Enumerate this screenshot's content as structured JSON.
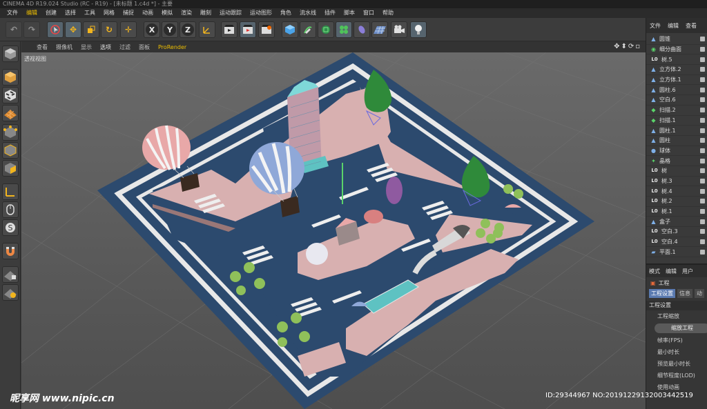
{
  "window": {
    "title": "CINEMA 4D R19.024 Studio (RC - R19) - [未标题 1.c4d *] - 主要"
  },
  "menu": [
    "文件",
    "编辑",
    "创建",
    "选择",
    "工具",
    "网格",
    "捕捉",
    "动画",
    "模拟",
    "渲染",
    "雕刻",
    "运动跟踪",
    "运动图形",
    "角色",
    "流水线",
    "插件",
    "脚本",
    "窗口",
    "帮助"
  ],
  "toolbar": {
    "axis_x": "X",
    "axis_y": "Y",
    "axis_z": "Z",
    "icons": [
      "undo-icon",
      "redo-icon",
      "select-icon",
      "move-icon",
      "scale-icon",
      "rotate-icon",
      "live-select-icon",
      "x-axis-icon",
      "y-axis-icon",
      "z-axis-icon",
      "coord-system-icon",
      "render-view-icon",
      "render-picture-icon",
      "render-settings-icon",
      "cube-icon",
      "pen-icon",
      "subdivide-icon",
      "array-icon",
      "deformer-icon",
      "floor-icon",
      "camera-icon",
      "light-icon"
    ]
  },
  "viewport": {
    "menu": [
      "查看",
      "摄像机",
      "显示",
      "选项",
      "过滤",
      "面板",
      "ProRender"
    ],
    "label": "透视视图"
  },
  "object_manager": {
    "tabs": [
      "文件",
      "编辑",
      "查看"
    ],
    "items": [
      {
        "label": "圆锥",
        "icon": "cone-icon"
      },
      {
        "label": "细分曲面",
        "icon": "subdivision-icon"
      },
      {
        "label": "树.5",
        "icon": "null-icon"
      },
      {
        "label": "立方体.2",
        "icon": "cube-icon"
      },
      {
        "label": "立方体.1",
        "icon": "cube-icon"
      },
      {
        "label": "圆柱.6",
        "icon": "cylinder-icon"
      },
      {
        "label": "空白.6",
        "icon": "null-icon"
      },
      {
        "label": "扫描.2",
        "icon": "sweep-icon"
      },
      {
        "label": "扫描.1",
        "icon": "sweep-icon"
      },
      {
        "label": "圆柱.1",
        "icon": "cylinder-icon"
      },
      {
        "label": "圆柱",
        "icon": "cylinder-icon"
      },
      {
        "label": "球体",
        "icon": "sphere-icon"
      },
      {
        "label": "晶格",
        "icon": "lattice-icon"
      },
      {
        "label": "树",
        "icon": "null-icon"
      },
      {
        "label": "树.3",
        "icon": "null-icon"
      },
      {
        "label": "树.4",
        "icon": "null-icon"
      },
      {
        "label": "树.2",
        "icon": "null-icon"
      },
      {
        "label": "树.1",
        "icon": "null-icon"
      },
      {
        "label": "盒子",
        "icon": "cube-icon"
      },
      {
        "label": "空白.3",
        "icon": "null-icon"
      },
      {
        "label": "空白.4",
        "icon": "null-icon"
      },
      {
        "label": "平面.1",
        "icon": "plane-icon"
      }
    ]
  },
  "attributes": {
    "tabs": [
      "模式",
      "编辑",
      "用户"
    ],
    "project_label": "工程",
    "subtabs": [
      "工程设置",
      "信息",
      "动"
    ],
    "section": "工程设置",
    "rows": [
      "工程缩放",
      "帧率(FPS)",
      "最小时长",
      "预览最小时长",
      "细节程度(LOD)",
      "使用动画"
    ],
    "scale_button": "缩放工程"
  },
  "watermark": {
    "site": "昵享网 www.nipic.cn",
    "id": "ID:29344967 NO:20191229132003442519"
  }
}
